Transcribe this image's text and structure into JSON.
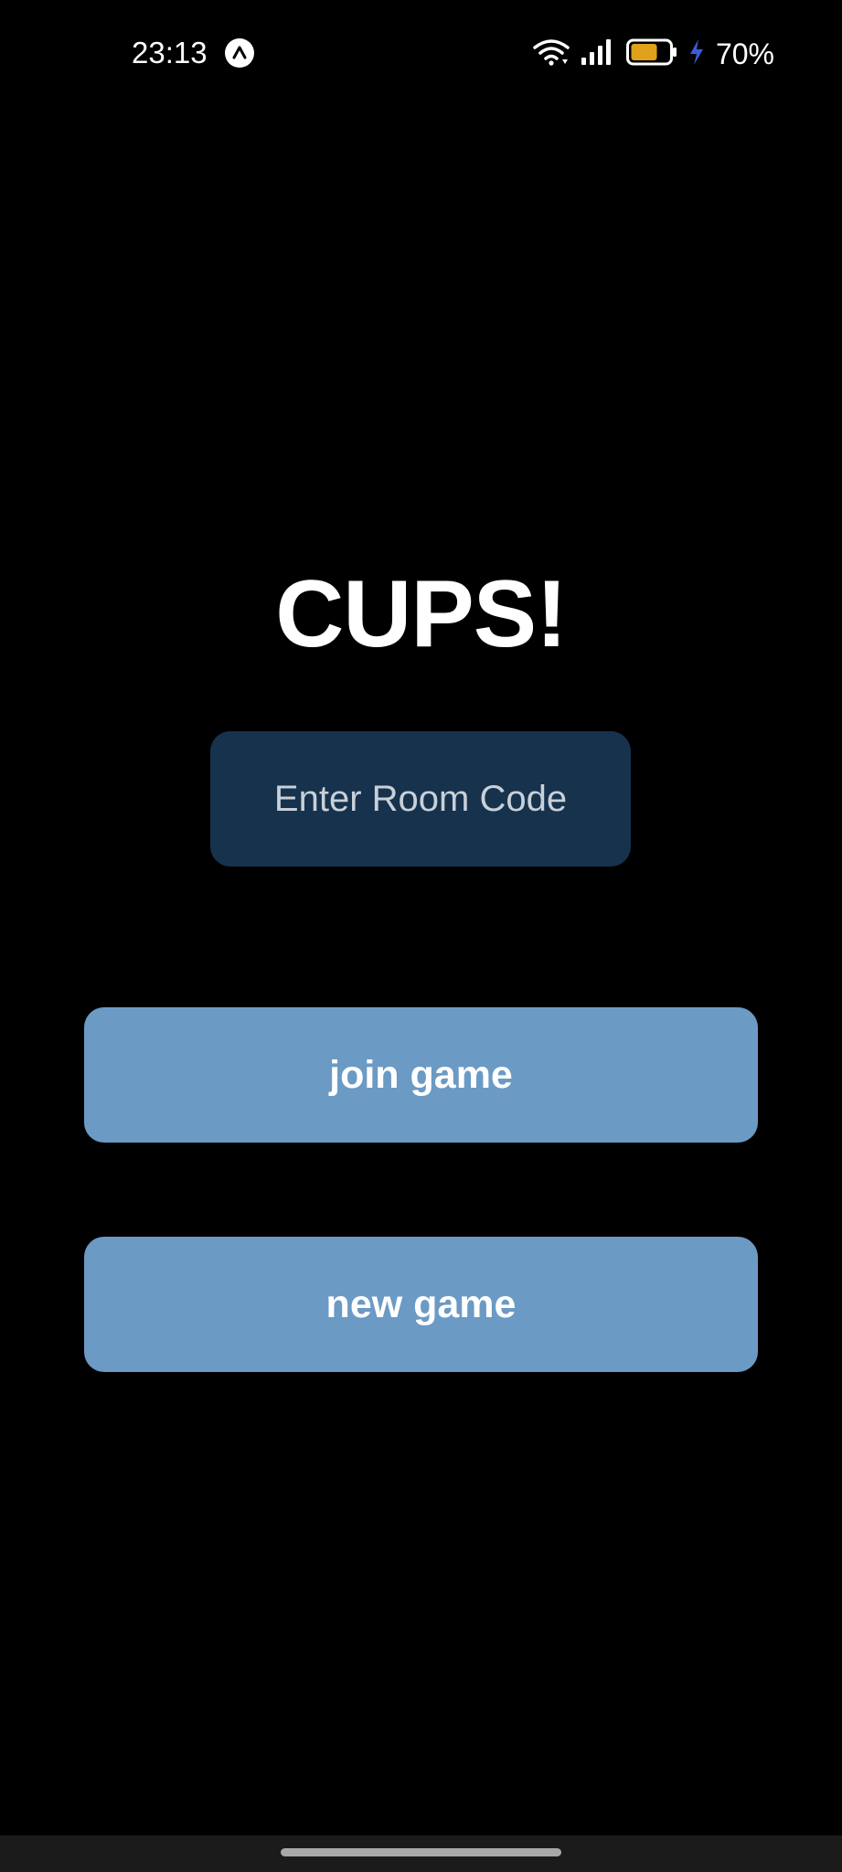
{
  "status_bar": {
    "time": "23:13",
    "app_icon": "caret-up-icon",
    "wifi_icon": "wifi-icon",
    "signal_icon": "signal-icon",
    "battery_icon": "battery-icon",
    "charging_icon": "lightning-icon",
    "battery_percent": "70%",
    "battery_level": 0.7,
    "battery_color": "#e0a21a",
    "charging_color": "#3b5bdb"
  },
  "app": {
    "title": "CUPS!"
  },
  "room_code": {
    "placeholder": "Enter Room Code",
    "value": ""
  },
  "actions": {
    "join_label": "join game",
    "new_label": "new game"
  },
  "colors": {
    "background": "#000000",
    "input_bg": "#17324d",
    "button_bg": "#6b9ac4"
  }
}
